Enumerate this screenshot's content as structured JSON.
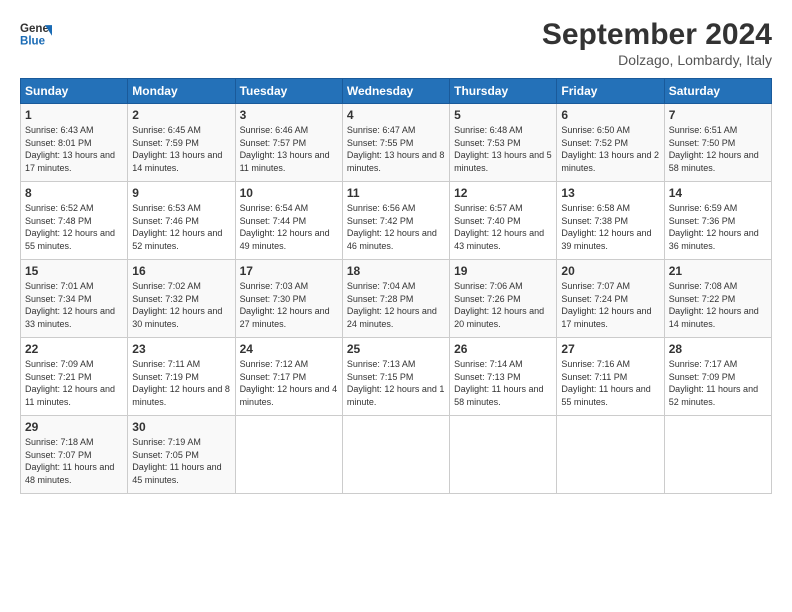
{
  "header": {
    "logo_line1": "General",
    "logo_line2": "Blue",
    "month_year": "September 2024",
    "location": "Dolzago, Lombardy, Italy"
  },
  "days_of_week": [
    "Sunday",
    "Monday",
    "Tuesday",
    "Wednesday",
    "Thursday",
    "Friday",
    "Saturday"
  ],
  "weeks": [
    [
      {
        "day": 1,
        "rise": "6:43 AM",
        "set": "8:01 PM",
        "daylight": "13 hours and 17 minutes."
      },
      {
        "day": 2,
        "rise": "6:45 AM",
        "set": "7:59 PM",
        "daylight": "13 hours and 14 minutes."
      },
      {
        "day": 3,
        "rise": "6:46 AM",
        "set": "7:57 PM",
        "daylight": "13 hours and 11 minutes."
      },
      {
        "day": 4,
        "rise": "6:47 AM",
        "set": "7:55 PM",
        "daylight": "13 hours and 8 minutes."
      },
      {
        "day": 5,
        "rise": "6:48 AM",
        "set": "7:53 PM",
        "daylight": "13 hours and 5 minutes."
      },
      {
        "day": 6,
        "rise": "6:50 AM",
        "set": "7:52 PM",
        "daylight": "13 hours and 2 minutes."
      },
      {
        "day": 7,
        "rise": "6:51 AM",
        "set": "7:50 PM",
        "daylight": "12 hours and 58 minutes."
      }
    ],
    [
      {
        "day": 8,
        "rise": "6:52 AM",
        "set": "7:48 PM",
        "daylight": "12 hours and 55 minutes."
      },
      {
        "day": 9,
        "rise": "6:53 AM",
        "set": "7:46 PM",
        "daylight": "12 hours and 52 minutes."
      },
      {
        "day": 10,
        "rise": "6:54 AM",
        "set": "7:44 PM",
        "daylight": "12 hours and 49 minutes."
      },
      {
        "day": 11,
        "rise": "6:56 AM",
        "set": "7:42 PM",
        "daylight": "12 hours and 46 minutes."
      },
      {
        "day": 12,
        "rise": "6:57 AM",
        "set": "7:40 PM",
        "daylight": "12 hours and 43 minutes."
      },
      {
        "day": 13,
        "rise": "6:58 AM",
        "set": "7:38 PM",
        "daylight": "12 hours and 39 minutes."
      },
      {
        "day": 14,
        "rise": "6:59 AM",
        "set": "7:36 PM",
        "daylight": "12 hours and 36 minutes."
      }
    ],
    [
      {
        "day": 15,
        "rise": "7:01 AM",
        "set": "7:34 PM",
        "daylight": "12 hours and 33 minutes."
      },
      {
        "day": 16,
        "rise": "7:02 AM",
        "set": "7:32 PM",
        "daylight": "12 hours and 30 minutes."
      },
      {
        "day": 17,
        "rise": "7:03 AM",
        "set": "7:30 PM",
        "daylight": "12 hours and 27 minutes."
      },
      {
        "day": 18,
        "rise": "7:04 AM",
        "set": "7:28 PM",
        "daylight": "12 hours and 24 minutes."
      },
      {
        "day": 19,
        "rise": "7:06 AM",
        "set": "7:26 PM",
        "daylight": "12 hours and 20 minutes."
      },
      {
        "day": 20,
        "rise": "7:07 AM",
        "set": "7:24 PM",
        "daylight": "12 hours and 17 minutes."
      },
      {
        "day": 21,
        "rise": "7:08 AM",
        "set": "7:22 PM",
        "daylight": "12 hours and 14 minutes."
      }
    ],
    [
      {
        "day": 22,
        "rise": "7:09 AM",
        "set": "7:21 PM",
        "daylight": "12 hours and 11 minutes."
      },
      {
        "day": 23,
        "rise": "7:11 AM",
        "set": "7:19 PM",
        "daylight": "12 hours and 8 minutes."
      },
      {
        "day": 24,
        "rise": "7:12 AM",
        "set": "7:17 PM",
        "daylight": "12 hours and 4 minutes."
      },
      {
        "day": 25,
        "rise": "7:13 AM",
        "set": "7:15 PM",
        "daylight": "12 hours and 1 minute."
      },
      {
        "day": 26,
        "rise": "7:14 AM",
        "set": "7:13 PM",
        "daylight": "11 hours and 58 minutes."
      },
      {
        "day": 27,
        "rise": "7:16 AM",
        "set": "7:11 PM",
        "daylight": "11 hours and 55 minutes."
      },
      {
        "day": 28,
        "rise": "7:17 AM",
        "set": "7:09 PM",
        "daylight": "11 hours and 52 minutes."
      }
    ],
    [
      {
        "day": 29,
        "rise": "7:18 AM",
        "set": "7:07 PM",
        "daylight": "11 hours and 48 minutes."
      },
      {
        "day": 30,
        "rise": "7:19 AM",
        "set": "7:05 PM",
        "daylight": "11 hours and 45 minutes."
      },
      null,
      null,
      null,
      null,
      null
    ]
  ]
}
